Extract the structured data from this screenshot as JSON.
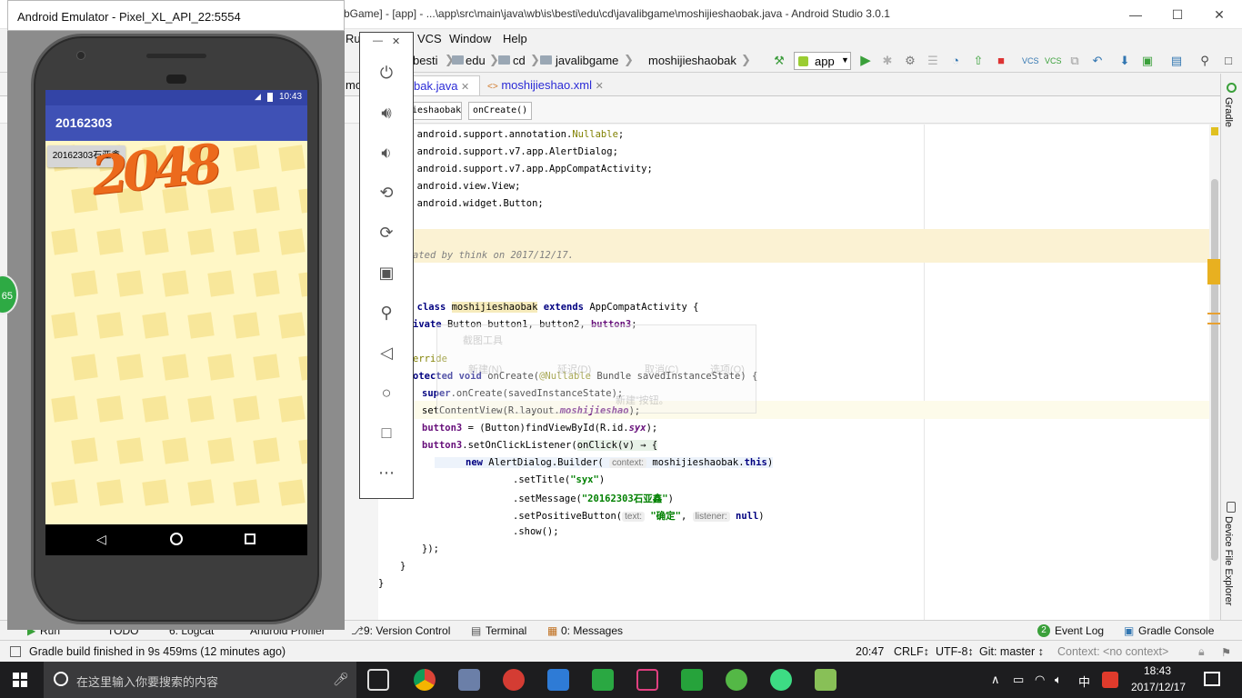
{
  "studio": {
    "title": "bGame] - [app] - ...\\app\\src\\main\\java\\wb\\is\\besti\\edu\\cd\\javalibgame\\moshijieshaobak.java - Android Studio 3.0.1",
    "menu": [
      "Ru",
      "VCS",
      "Window",
      "Help"
    ],
    "breadcrumbs": [
      "besti",
      "edu",
      "cd",
      "javalibgame",
      "moshijieshaobak"
    ],
    "run_config": "app",
    "tabs": [
      "mo",
      "bak.java",
      "moshijieshao.xml"
    ],
    "structure": [
      "ieshaobak",
      "onCreate()"
    ],
    "right_strip": [
      "Gradle",
      "Device File Explorer"
    ],
    "bottom_tools": {
      "run": "Run",
      "todo": "TODO",
      "logcat": "6: Logcat",
      "profiler": "Android Profiler",
      "vcs": "9: Version Control",
      "terminal": "Terminal",
      "messages": "0: Messages",
      "event_log": "Event Log",
      "event_count": "2",
      "gradle_console": "Gradle Console"
    },
    "status": {
      "message": "Gradle build finished in 9s 459ms (12 minutes ago)",
      "position": "20:47",
      "line_sep": "CRLF↕",
      "encoding": "UTF-8↕",
      "git": "Git: master ↕",
      "context": "Context: <no context>"
    },
    "code": {
      "l1": ": android.support.annotation.",
      "l1b": "Nullable",
      "l2": ": android.support.v7.app.AlertDialog;",
      "l3": ": android.support.v7.app.AppCompatActivity;",
      "l4": ": android.view.View;",
      "l5": ": android.widget.Button;",
      "l6": "ated by think on 2017/12/17.",
      "l7a": ": ",
      "l7b": "class ",
      "l7c": "moshijieshaobak",
      "l7d": " extends ",
      "l7e": "AppCompatActivity {",
      "l8a": "ivate ",
      "l8b": "Button button1, button2, ",
      "l8c": "button3",
      "l9": "erride",
      "l10a": "otected void ",
      "l10b": "onCreate(",
      "l10c": "@Nullable",
      "l10d": " Bundle savedInstanceState) {",
      "l11a": "super",
      "l11b": ".onCreate(savedInstanceState);",
      "l12a": "setContentView(R.layout.",
      "l12b": "moshijieshao",
      "l12c": ");",
      "l13a": "button3",
      "l13b": " = (Button)findViewById(R.id.",
      "l13c": "syx",
      "l13d": ");",
      "l14a": "button3",
      "l14b": ".setOnClickListener(",
      "l14c": "onClick(v) → {",
      "l15a": "new ",
      "l15b": "AlertDialog.Builder(",
      "l15c": "context:",
      "l15d": " moshijieshaobak.",
      "l15e": "this",
      "l15f": ")",
      "l16a": ".setTitle(",
      "l16b": "\"syx\"",
      "l16c": ")",
      "l17a": ".setMessage(",
      "l17b": "\"20162303石亚鑫\"",
      "l17c": ")",
      "l18a": ".setPositiveButton(",
      "l18b": "text:",
      "l18c": "\"确定\"",
      "l18d": ", ",
      "l18e": "listener:",
      "l18f": "null",
      "l18g": ")",
      "l19": ".show();",
      "l20": "});",
      "l21": "}",
      "l22": "}"
    },
    "ghost_tool": {
      "title": "截图工具",
      "new": "新建(N)",
      "delay": "延迟(D)",
      "cancel": "取消(C)",
      "options": "选项(O)",
      "hint": "新建”按钮。"
    }
  },
  "emulator": {
    "title": "Android Emulator - Pixel_XL_API_22:5554",
    "time": "10:43",
    "app_title": "20162303",
    "button_label": "20162303石亚鑫",
    "logo_text": "2048",
    "side_badge": "65"
  },
  "taskbar": {
    "search_placeholder": "在这里输入你要搜索的内容",
    "ime": "中",
    "time": "18:43",
    "date": "2017/12/17"
  }
}
